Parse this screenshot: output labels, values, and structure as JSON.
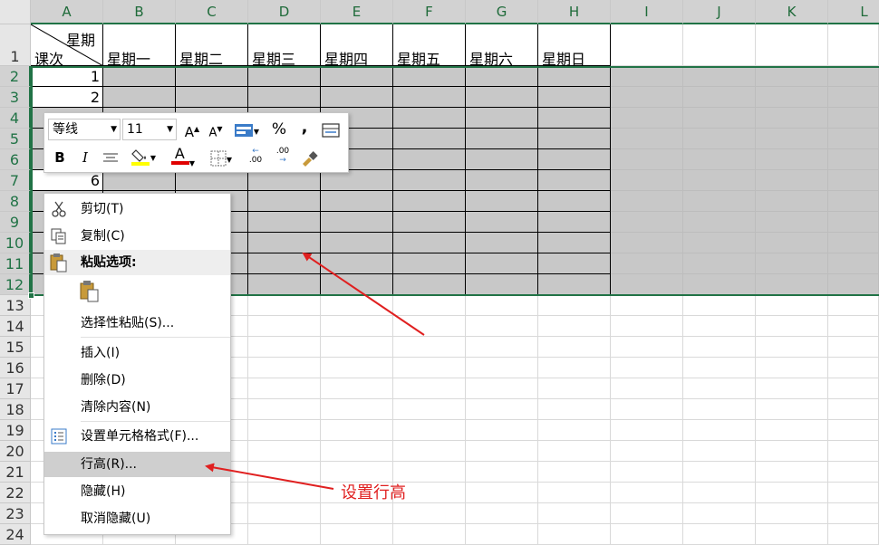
{
  "columns": [
    "A",
    "B",
    "C",
    "D",
    "E",
    "F",
    "G",
    "H",
    "I",
    "J",
    "K",
    "L"
  ],
  "rows": [
    "1",
    "2",
    "3",
    "4",
    "5",
    "6",
    "7",
    "8",
    "9",
    "10",
    "11",
    "12",
    "13",
    "14",
    "15",
    "16",
    "17",
    "18",
    "19",
    "20",
    "21",
    "22",
    "23",
    "24"
  ],
  "table": {
    "corner_top": "星期",
    "corner_bottom": "课次",
    "days": [
      "星期一",
      "星期二",
      "星期三",
      "星期四",
      "星期五",
      "星期六",
      "星期日"
    ],
    "lesson_numbers": [
      "1",
      "2",
      "6"
    ]
  },
  "mini_toolbar": {
    "font_name": "等线",
    "font_size": "11",
    "bold": "B",
    "italic": "I",
    "percent": "%",
    "comma": ",",
    "inc_font": "A",
    "dec_font": "A",
    "font_color_glyph": "A",
    "inc_decimal": ".00",
    "dec_decimal": ".00",
    "highlight_color": "#ffff00",
    "font_color": "#e00000"
  },
  "context_menu": {
    "cut": "剪切(T)",
    "copy": "复制(C)",
    "paste_options": "粘贴选项:",
    "paste_special": "选择性粘贴(S)...",
    "insert": "插入(I)",
    "delete": "删除(D)",
    "clear_contents": "清除内容(N)",
    "format_cells": "设置单元格格式(F)...",
    "row_height": "行高(R)...",
    "hide": "隐藏(H)",
    "unhide": "取消隐藏(U)"
  },
  "annotation": {
    "label": "设置行高",
    "color": "#e02020"
  },
  "colors": {
    "selection_fill": "#c8c8c8",
    "selection_border": "#217346",
    "header_bg": "#e6e6e6"
  }
}
